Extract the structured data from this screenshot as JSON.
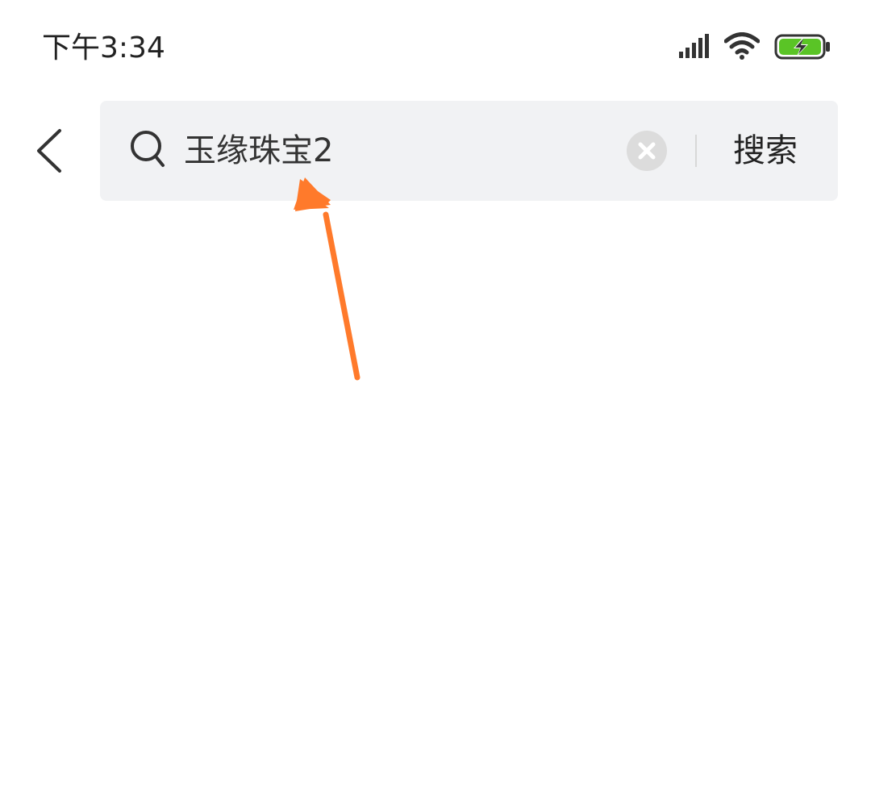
{
  "status_bar": {
    "time": "下午3:34",
    "signal_icon": "signal-strength-icon",
    "wifi_icon": "wifi-icon",
    "battery_icon": "battery-charging-icon",
    "battery_color": "#5ac426"
  },
  "header": {
    "back_icon": "chevron-left-icon",
    "search": {
      "value": "玉缘珠宝2",
      "icon": "search-icon",
      "clear_icon": "clear-circle-icon"
    },
    "submit_label": "搜索"
  },
  "annotation": {
    "icon": "arrow-annotation",
    "color": "#ff7a2b"
  },
  "colors": {
    "search_background": "#f1f2f4",
    "text": "#222222"
  }
}
